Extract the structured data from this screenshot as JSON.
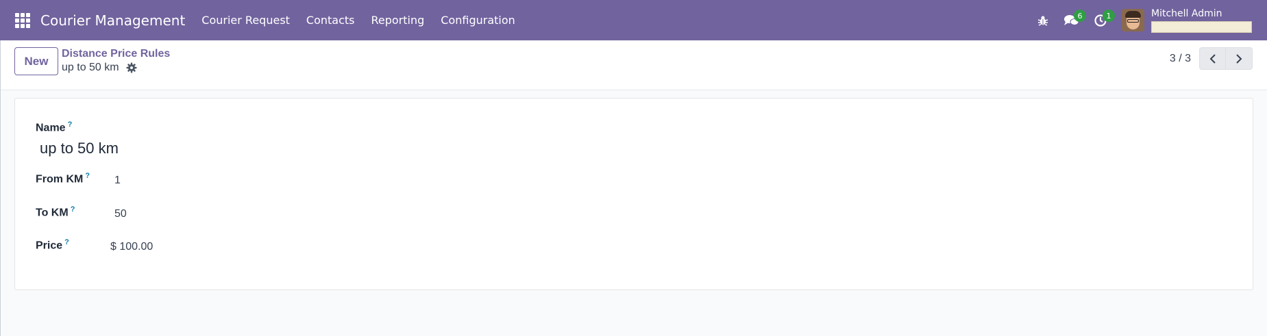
{
  "navbar": {
    "app_title": "Courier Management",
    "menu": [
      "Courier Request",
      "Contacts",
      "Reporting",
      "Configuration"
    ],
    "messages_count": "6",
    "activities_count": "1",
    "user_name": "Mitchell Admin",
    "accent_color": "#71639e"
  },
  "control_panel": {
    "new_label": "New",
    "breadcrumb_parent": "Distance Price Rules",
    "record_name": "up to 50 km",
    "pager": "3 / 3"
  },
  "form": {
    "help_mark": "?",
    "name_label": "Name",
    "name_value": "up to 50 km",
    "from_km_label": "From KM",
    "from_km_value": "1",
    "to_km_label": "To KM",
    "to_km_value": "50",
    "price_label": "Price",
    "price_value": "$ 100.00"
  }
}
